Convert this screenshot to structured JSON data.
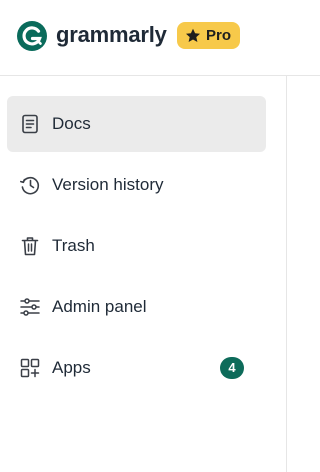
{
  "brand": {
    "name": "grammarly",
    "logo_icon": "grammarly-g-logo",
    "logo_color": "#15c39a",
    "logo_bg": "#0a6b5b"
  },
  "plan_badge": {
    "label": "Pro",
    "icon": "star-icon",
    "color": "#f7c94a"
  },
  "sidebar": {
    "items": [
      {
        "label": "Docs",
        "icon": "document-icon",
        "active": true
      },
      {
        "label": "Version history",
        "icon": "history-icon",
        "active": false
      },
      {
        "label": "Trash",
        "icon": "trash-icon",
        "active": false
      },
      {
        "label": "Admin panel",
        "icon": "sliders-icon",
        "active": false
      },
      {
        "label": "Apps",
        "icon": "apps-grid-icon",
        "active": false,
        "badge": "4"
      }
    ],
    "badge_color": "#0d6b5a",
    "active_bg": "#ebebeb"
  }
}
